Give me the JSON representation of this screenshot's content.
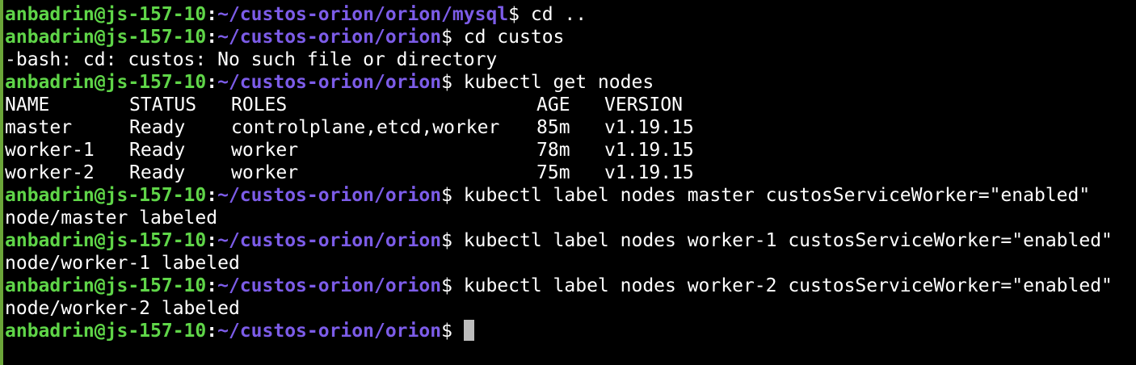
{
  "terminal": {
    "prompt_user": "anbadrin@js-157-10",
    "prompt_colon": ":",
    "prompt_symbol": "$",
    "lines": [
      {
        "type": "prompt",
        "path": "~/custos-orion/orion/mysql",
        "cmd": " cd .."
      },
      {
        "type": "prompt",
        "path": "~/custos-orion/orion",
        "cmd": " cd custos"
      },
      {
        "type": "output",
        "text": "-bash: cd: custos: No such file or directory"
      },
      {
        "type": "prompt",
        "path": "~/custos-orion/orion",
        "cmd": " kubectl get nodes"
      },
      {
        "type": "table",
        "cells": [
          "NAME",
          "STATUS",
          "ROLES",
          "AGE",
          "VERSION"
        ]
      },
      {
        "type": "table",
        "cells": [
          "master",
          "Ready",
          "controlplane,etcd,worker",
          "85m",
          "v1.19.15"
        ]
      },
      {
        "type": "table",
        "cells": [
          "worker-1",
          "Ready",
          "worker",
          "78m",
          "v1.19.15"
        ]
      },
      {
        "type": "table",
        "cells": [
          "worker-2",
          "Ready",
          "worker",
          "75m",
          "v1.19.15"
        ]
      },
      {
        "type": "prompt",
        "path": "~/custos-orion/orion",
        "cmd": " kubectl label nodes master custosServiceWorker=\"enabled\""
      },
      {
        "type": "output",
        "text": "node/master labeled"
      },
      {
        "type": "prompt",
        "path": "~/custos-orion/orion",
        "cmd": " kubectl label nodes worker-1 custosServiceWorker=\"enabled\""
      },
      {
        "type": "output",
        "text": "node/worker-1 labeled"
      },
      {
        "type": "prompt",
        "path": "~/custos-orion/orion",
        "cmd": " kubectl label nodes worker-2 custosServiceWorker=\"enabled\""
      },
      {
        "type": "output",
        "text": "node/worker-2 labeled"
      },
      {
        "type": "prompt",
        "path": "~/custos-orion/orion",
        "cmd": " ",
        "cursor": true
      }
    ]
  },
  "colors": {
    "background": "#000000",
    "user": "#5fd548",
    "path": "#7c5ce8",
    "text": "#ffffff",
    "cursor": "#bdbdbd",
    "left_border": "#6ba539"
  }
}
